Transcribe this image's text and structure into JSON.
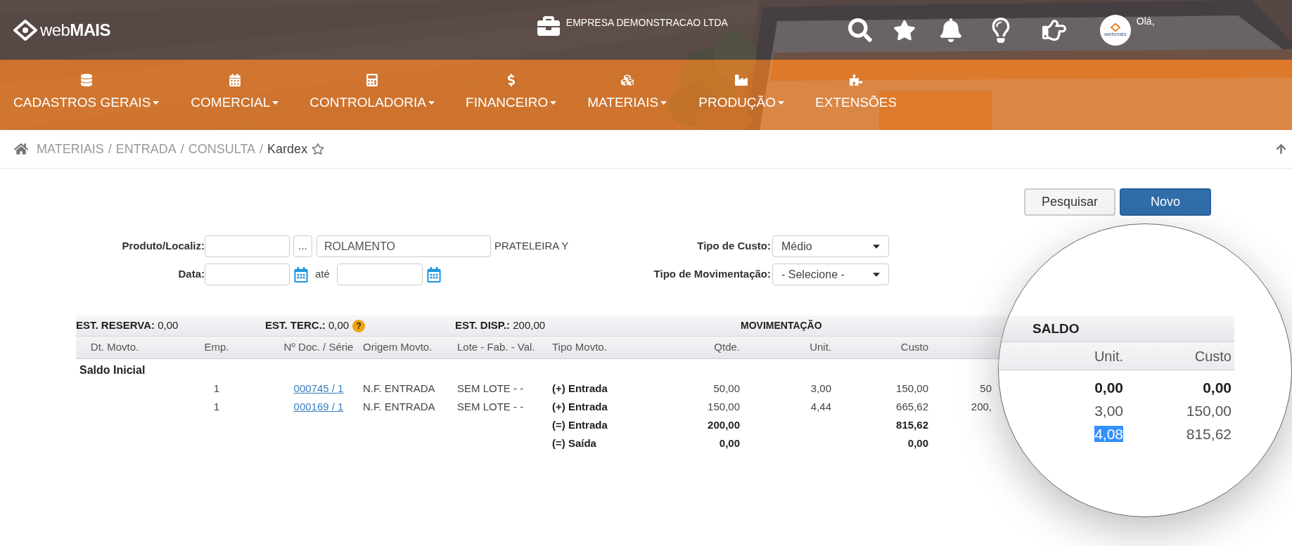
{
  "header": {
    "logo": "web**MAIS**",
    "company": "EMPRESA DEMONSTRACAO LTDA",
    "avatar_label": "webmais",
    "greeting": "Olá,"
  },
  "nav": [
    {
      "label": "CADASTROS GERAIS",
      "has_caret": true
    },
    {
      "label": "COMERCIAL",
      "has_caret": true
    },
    {
      "label": "CONTROLADORIA",
      "has_caret": true
    },
    {
      "label": "FINANCEIRO",
      "has_caret": true
    },
    {
      "label": "MATERIAIS",
      "has_caret": true
    },
    {
      "label": "PRODUÇÃO",
      "has_caret": true
    },
    {
      "label": "EXTENSÕES",
      "has_caret": false
    }
  ],
  "breadcrumb": {
    "items": [
      "MATERIAIS",
      "ENTRADA",
      "CONSULTA"
    ],
    "separator": "/",
    "current": "Kardex",
    "favorite": false
  },
  "buttons": [
    {
      "label": "Pesquisar",
      "kind": "default"
    },
    {
      "label": "Novo",
      "kind": "primary"
    }
  ],
  "form": {
    "product_label": "Produto/Localiz:",
    "lookup_button": "...",
    "product_description": "ROLAMENTO",
    "location": "PRATELEIRA Y",
    "date_label": "Data:",
    "date_between": "até",
    "cost_type_label": "Tipo de Custo:",
    "cost_type": "Médio",
    "movement_type_label": "Tipo de Movimentação:",
    "movement_type": "- Selecione -"
  },
  "summary": [
    {
      "label": "EST. RESERVA:",
      "value": "0,00"
    },
    {
      "label": "EST. TERC.:",
      "value": "0,00",
      "help": "?"
    },
    {
      "label": "EST. DISP.:",
      "value": "200,00"
    }
  ],
  "group_title": "MOVIMENTAÇÃO",
  "columns": [
    "Dt. Movto.",
    "Emp.",
    "Nº Doc. / Série",
    "Origem Movto.",
    "Lote - Fab. - Val.",
    "Tipo Movto.",
    "Qtde.",
    "Unit.",
    "Custo"
  ],
  "rows": [
    {
      "kind": "section",
      "label": "Saldo Inicial"
    },
    {
      "kind": "entry",
      "emp": "1",
      "doc": "000745 / 1",
      "origem": "N.F. ENTRADA",
      "lote": "SEM LOTE - -",
      "tipo": "(+) Entrada",
      "qtde": "50,00",
      "unit": "3,00",
      "custo": "150,00",
      "column_10": "50"
    },
    {
      "kind": "entry",
      "emp": "1",
      "doc": "000169 / 1",
      "origem": "N.F. ENTRADA",
      "lote": "SEM LOTE - -",
      "tipo": "(+) Entrada",
      "qtde": "150,00",
      "unit": "4,44",
      "custo": "665,62",
      "column_10": "200,"
    },
    {
      "kind": "total",
      "tipo": "(=) Entrada",
      "qtde": "200,00",
      "custo": "815,62"
    },
    {
      "kind": "total",
      "tipo": "(=) Saída",
      "qtde": "0,00",
      "custo": "0,00"
    }
  ],
  "magnifier": {
    "title": "SALDO",
    "columns": [
      "Unit.",
      "Custo"
    ],
    "rows": [
      {
        "unit": "0,00",
        "custo": "0,00",
        "bold": true,
        "highlighted": false
      },
      {
        "unit": "3,00",
        "custo": "150,00",
        "bold": false,
        "highlighted": false
      },
      {
        "unit": "4,08",
        "custo": "815,62",
        "bold": false,
        "highlighted": true
      }
    ]
  }
}
